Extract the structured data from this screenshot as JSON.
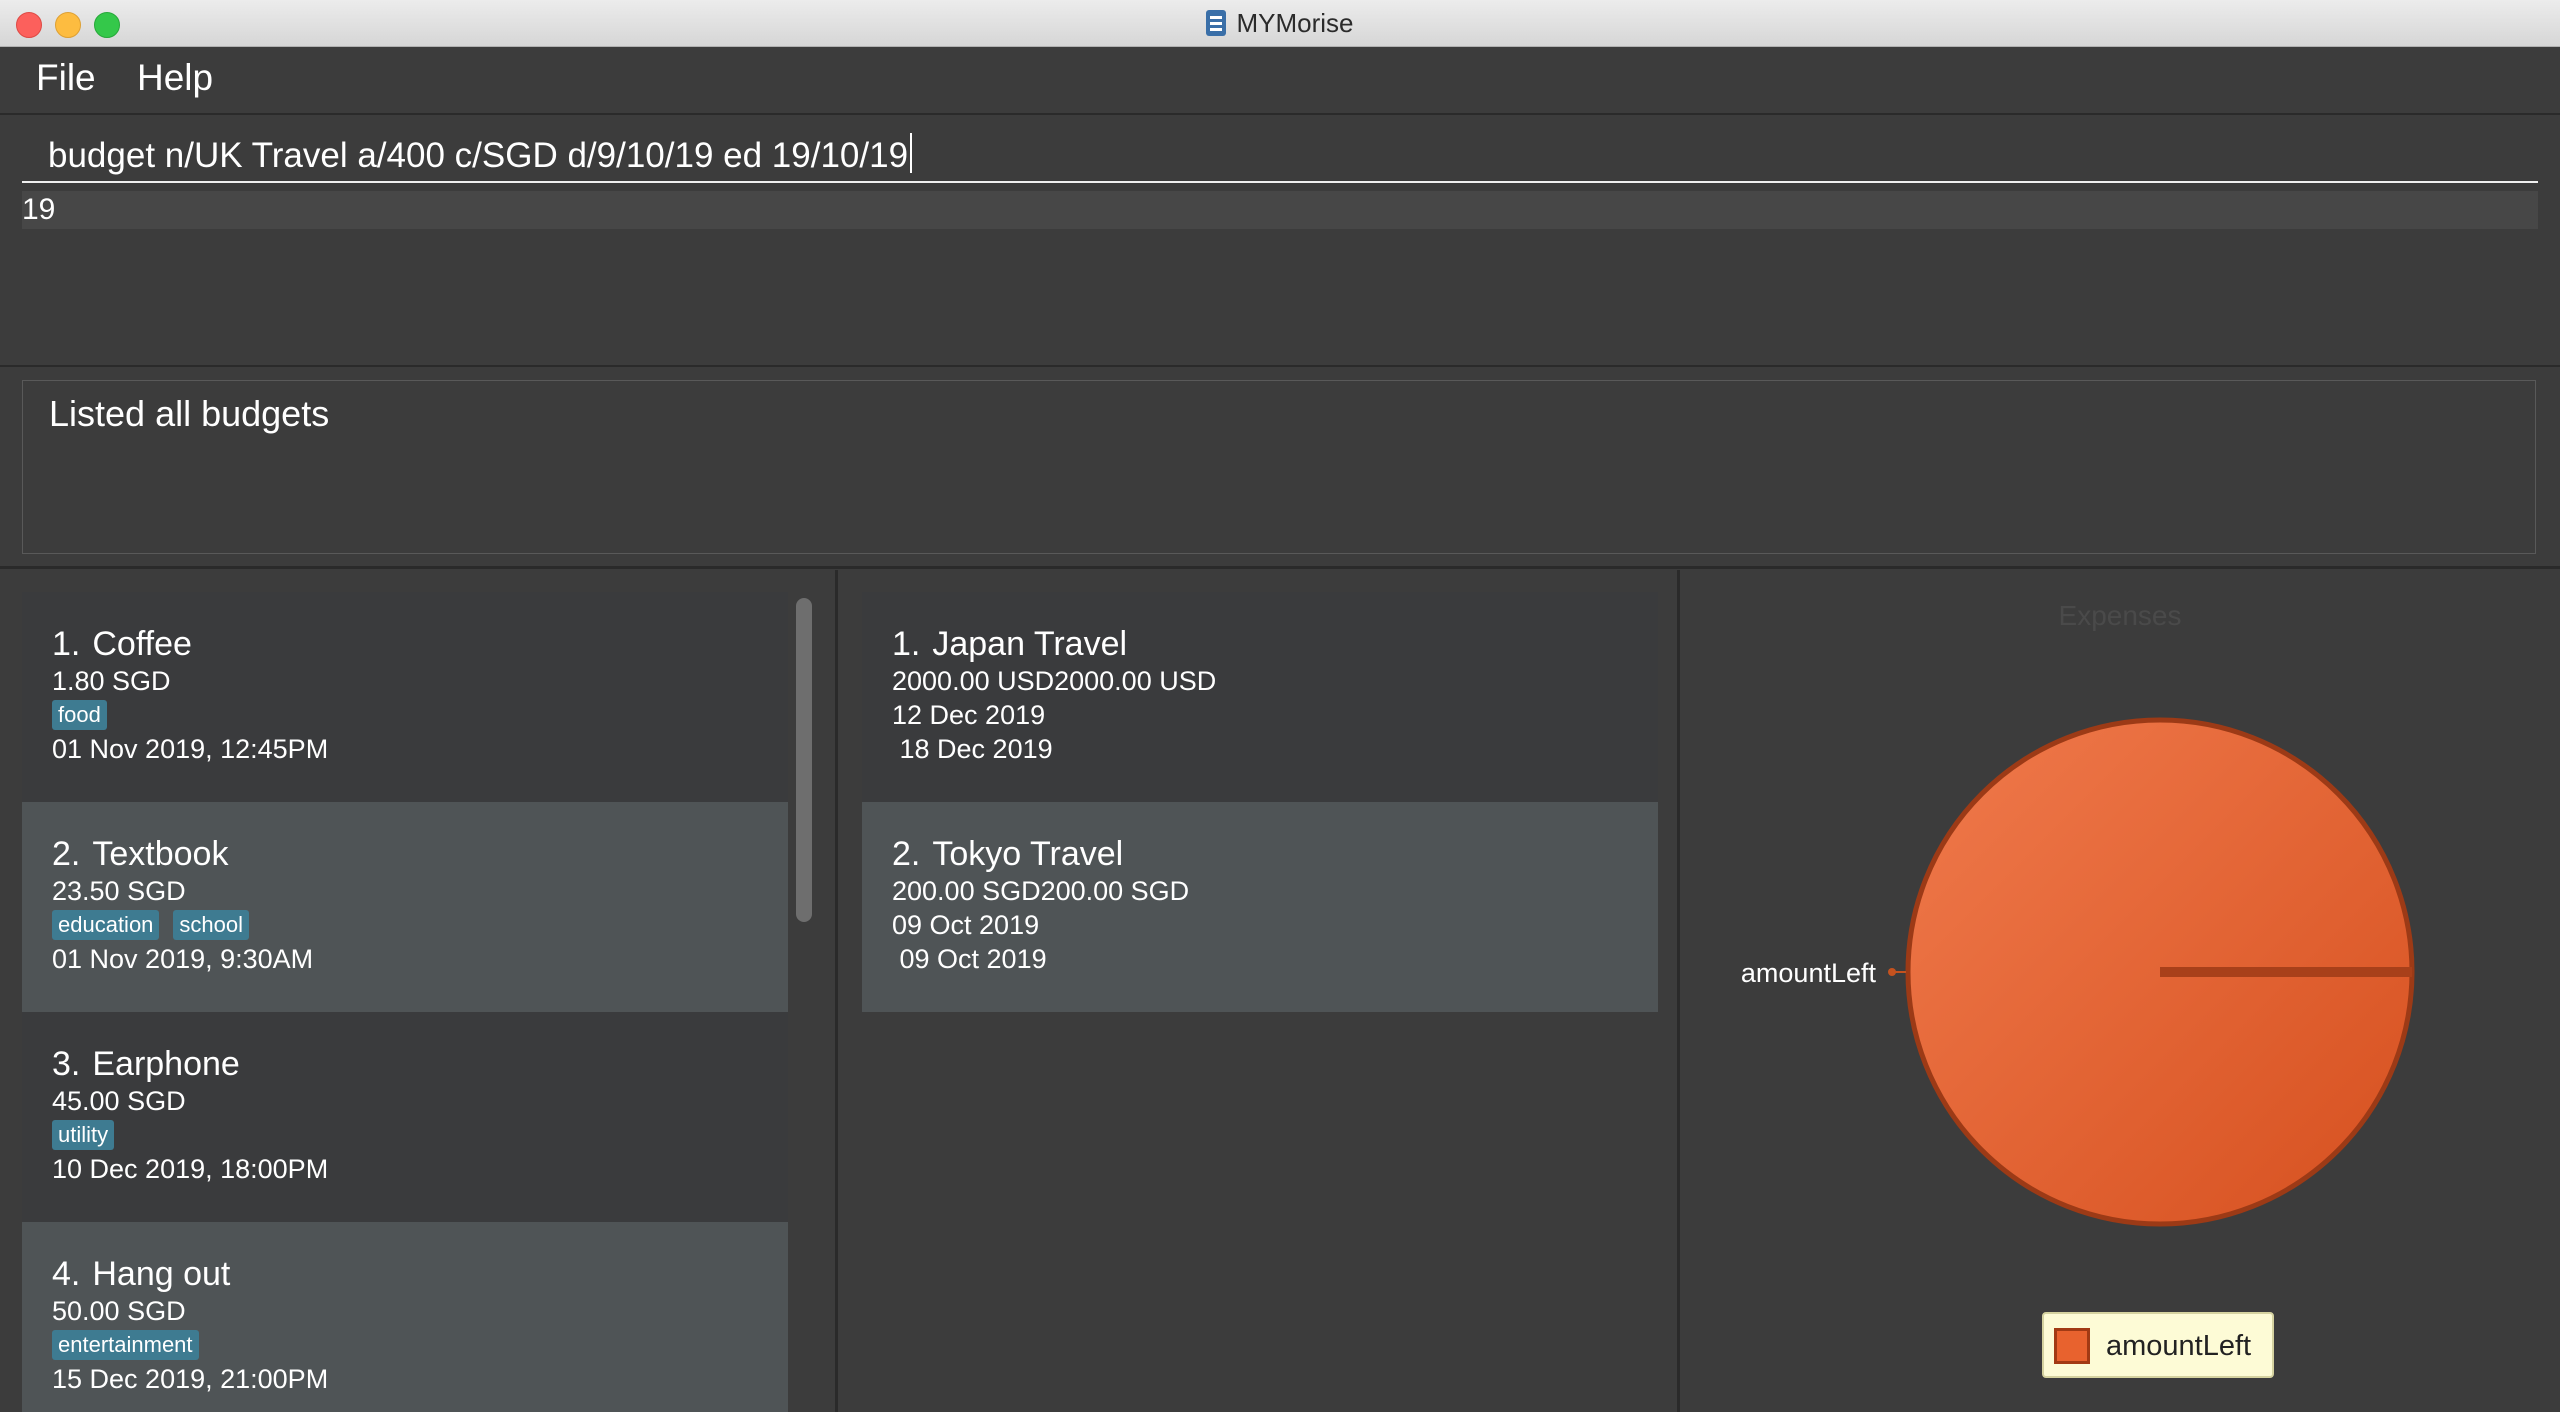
{
  "window": {
    "title": "MYMorise"
  },
  "menu": {
    "file": "File",
    "help": "Help"
  },
  "command": {
    "input": "budget n/UK Travel a/400 c/SGD d/9/10/19 ed 19/10/19",
    "suggestion": "19"
  },
  "result": {
    "message": "Listed all budgets"
  },
  "expenses": [
    {
      "index": "1.",
      "name": "Coffee",
      "amount": "1.80 SGD",
      "tags": [
        "food"
      ],
      "date": "01 Nov 2019, 12:45PM"
    },
    {
      "index": "2.",
      "name": "Textbook",
      "amount": "23.50 SGD",
      "tags": [
        "education",
        "school"
      ],
      "date": "01 Nov 2019, 9:30AM"
    },
    {
      "index": "3.",
      "name": "Earphone",
      "amount": "45.00 SGD",
      "tags": [
        "utility"
      ],
      "date": "10 Dec 2019, 18:00PM"
    },
    {
      "index": "4.",
      "name": "Hang out",
      "amount": "50.00 SGD",
      "tags": [
        "entertainment"
      ],
      "date": "15 Dec 2019, 21:00PM"
    }
  ],
  "budgets": [
    {
      "index": "1.",
      "name": "Japan Travel",
      "amount": "2000.00 USD2000.00 USD",
      "start": "12 Dec 2019",
      "end": " 18 Dec 2019"
    },
    {
      "index": "2.",
      "name": "Tokyo Travel",
      "amount": "200.00 SGD200.00 SGD",
      "start": "09 Oct 2019",
      "end": " 09 Oct 2019"
    }
  ],
  "chart_data": {
    "type": "pie",
    "title": "Expenses",
    "categories": [
      "amountLeft"
    ],
    "values": [
      100
    ],
    "legend": [
      "amountLeft"
    ],
    "legend_placement": "bottom",
    "colors": [
      "#e8622e"
    ]
  }
}
